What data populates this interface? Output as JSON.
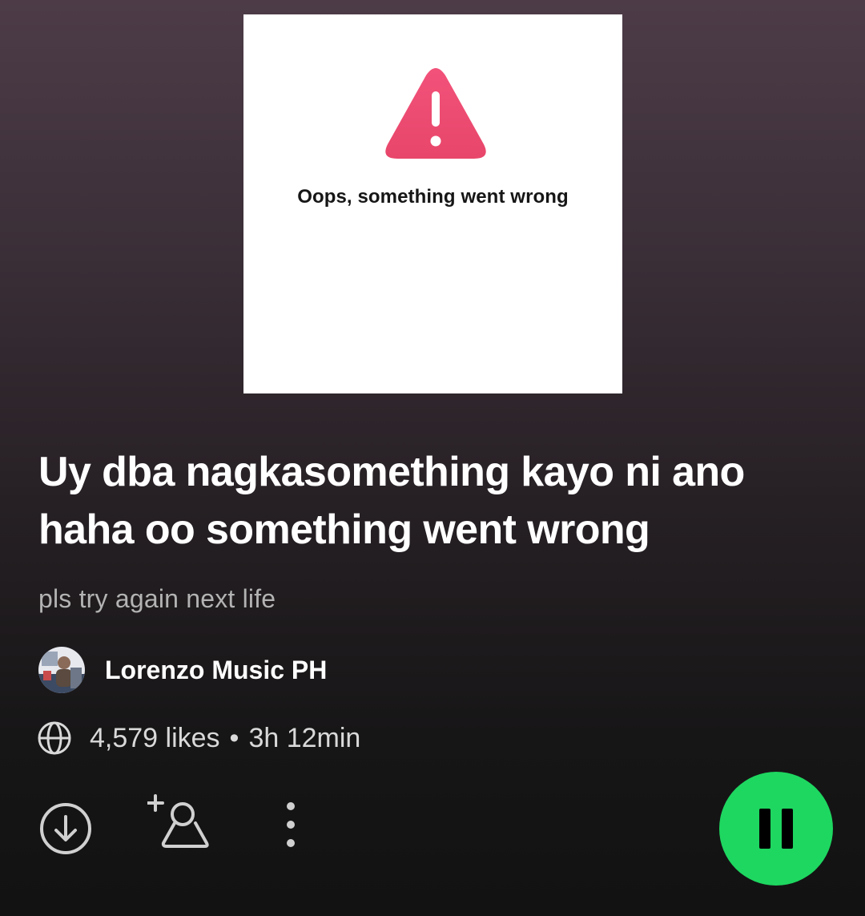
{
  "cover": {
    "icon": "warning-triangle-icon",
    "message": "Oops, something went wrong",
    "icon_color": "#ec4f6f"
  },
  "playlist": {
    "title": "Uy dba nagkasomething kayo ni ano haha oo something went wrong",
    "description": "pls try again next life",
    "owner": "Lorenzo Music PH",
    "likes": "4,579 likes",
    "separator": "•",
    "duration": "3h 12min"
  },
  "actions": {
    "download_icon": "download-icon",
    "follow_icon": "add-follow-icon",
    "more_icon": "more-options-icon",
    "play_state_icon": "pause-icon"
  },
  "colors": {
    "accent": "#1ed760",
    "text_secondary": "#b3b3b3"
  }
}
